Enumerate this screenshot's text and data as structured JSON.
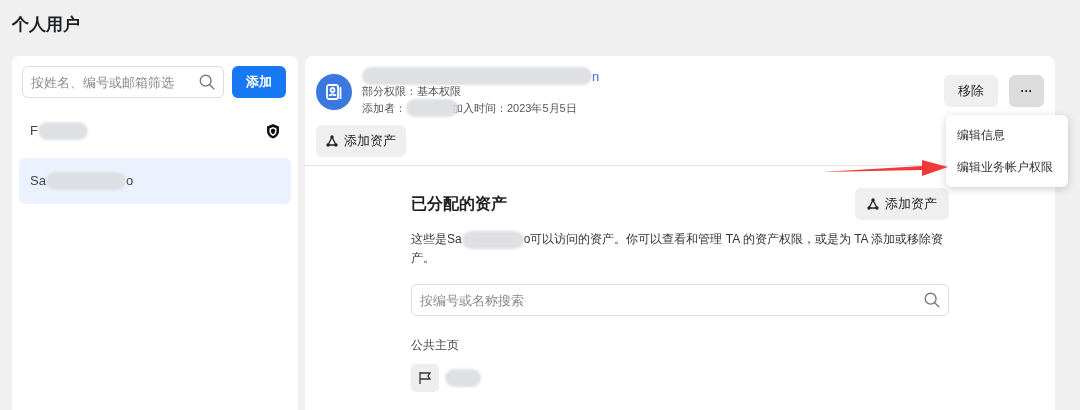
{
  "page_title": "个人用户",
  "sidebar": {
    "search": {
      "placeholder": "按姓名、编号或邮箱筛选"
    },
    "add_button": "添加",
    "users": [
      {
        "name_start": "F",
        "admin": true,
        "selected": false
      },
      {
        "name_start": "Sa",
        "name_end": "o",
        "admin": false,
        "selected": true
      }
    ]
  },
  "header": {
    "email_end": "n",
    "permission": "部分权限：基本权限",
    "added_by": "添加者：",
    "joined": "加入时间：2023年5月5日",
    "add_asset_button": "添加资产",
    "remove_button": "移除",
    "more_button": "···"
  },
  "menu": {
    "items": [
      "编辑信息",
      "编辑业务帐户权限"
    ]
  },
  "assets": {
    "title": "已分配的资产",
    "add_asset_button": "添加资产",
    "desc_start": "这些是Sa",
    "desc_end": "o可以访问的资产。你可以查看和管理 TA 的资产权限，或是为 TA 添加或移除资产。",
    "search": {
      "placeholder": "按编号或名称搜索"
    },
    "sections": [
      {
        "title": "公共主页",
        "items": [
          {
            "kind": "page"
          }
        ]
      }
    ]
  }
}
